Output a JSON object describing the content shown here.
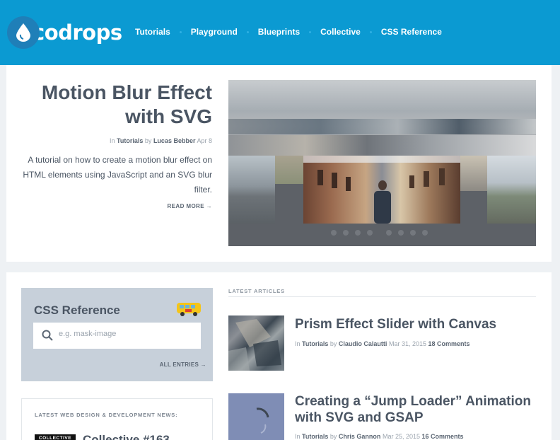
{
  "header": {
    "logo_text": "codrops",
    "nav": [
      "Tutorials",
      "Playground",
      "Blueprints",
      "Collective",
      "CSS Reference"
    ],
    "colors": {
      "brand": "#0b9ad2"
    }
  },
  "hero": {
    "title": "Motion Blur Effect with SVG",
    "meta_in": "In",
    "meta_category": "Tutorials",
    "meta_by": "by",
    "meta_author": "Lucas Bebber",
    "meta_date": "Apr 8",
    "description": "A tutorial on how to create a motion blur effect on HTML elements using JavaScript and an SVG blur filter.",
    "read_more": "READ MORE →",
    "slider_dot_count": 8
  },
  "css_reference": {
    "title": "CSS Reference",
    "search_placeholder": "e.g. mask-image",
    "all_entries": "ALL ENTRIES →",
    "icon": "school-bus-icon"
  },
  "news": {
    "heading": "LATEST WEB DESIGN & DEVELOPMENT NEWS:",
    "tag": "COLLECTIVE",
    "title": "Collective #163"
  },
  "latest": {
    "heading": "LATEST ARTICLES",
    "articles": [
      {
        "title": "Prism Effect Slider with Canvas",
        "in": "In",
        "category": "Tutorials",
        "by": "by",
        "author": "Claudio Calautti",
        "date": "Mar 31, 2015",
        "comments": "18 Comments"
      },
      {
        "title": "Creating a “Jump Loader” Animation with SVG and GSAP",
        "in": "In",
        "category": "Tutorials",
        "by": "by",
        "author": "Chris Gannon",
        "date": "Mar 25, 2015",
        "comments": "16 Comments"
      }
    ]
  }
}
